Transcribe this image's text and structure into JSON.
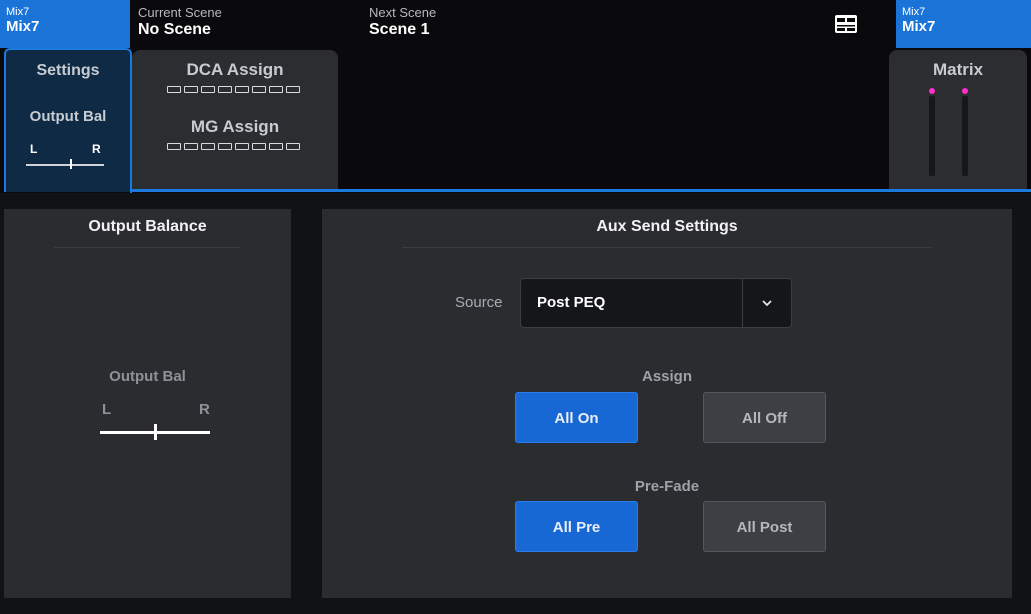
{
  "header": {
    "left_chip": {
      "small": "Mix7",
      "big": "Mix7"
    },
    "current_scene": {
      "caption": "Current Scene",
      "value": "No Scene"
    },
    "next_scene": {
      "caption": "Next Scene",
      "value": "Scene 1"
    },
    "right_chip": {
      "small": "Mix7",
      "big": "Mix7"
    },
    "sd_icon": "sdhc-card-icon"
  },
  "tabs": {
    "settings": {
      "label": "Settings",
      "sublabel": "Output Bal",
      "bal_l": "L",
      "bal_r": "R"
    },
    "dca_assign": {
      "label": "DCA Assign",
      "slots": 8
    },
    "mg_assign": {
      "label": "MG Assign",
      "slots": 8
    },
    "matrix": {
      "label": "Matrix"
    }
  },
  "output_balance_panel": {
    "title": "Output Balance",
    "control_label": "Output Bal",
    "left_label": "L",
    "right_label": "R"
  },
  "aux_panel": {
    "title": "Aux Send Settings",
    "source_label": "Source",
    "source_value": "Post PEQ",
    "assign_label": "Assign",
    "all_on": "All On",
    "all_off": "All Off",
    "prefade_label": "Pre-Fade",
    "all_pre": "All Pre",
    "all_post": "All Post"
  },
  "colors": {
    "accent": "#1b7ae0",
    "active_button": "#1768d4",
    "meter_dot": "#ff2fc8"
  }
}
